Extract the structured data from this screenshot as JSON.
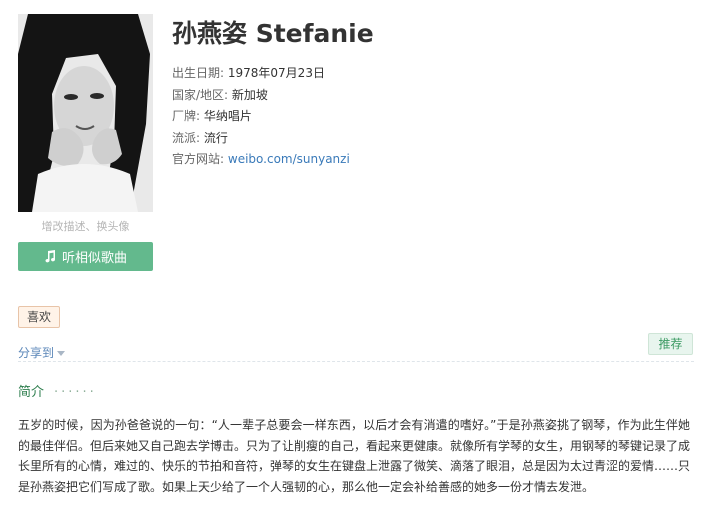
{
  "artist": {
    "name": "孙燕姿 Stefanie"
  },
  "photo": {
    "edit_label": "增改描述、换头像"
  },
  "actions": {
    "similar_songs_label": "听相似歌曲",
    "like_label": "喜欢",
    "share_label": "分享到",
    "recommend_label": "推荐"
  },
  "info": [
    {
      "label": "出生日期:",
      "value": "1978年07月23日"
    },
    {
      "label": "国家/地区:",
      "value": "新加坡"
    },
    {
      "label": "厂牌:",
      "value": "华纳唱片"
    },
    {
      "label": "流派:",
      "value": "流行"
    }
  ],
  "website": {
    "label": "官方网站:",
    "url": "weibo.com/sunyanzi"
  },
  "intro": {
    "heading": "简介",
    "dots": "······",
    "text": "五岁的时候，因为孙爸爸说的一句：“人一辈子总要会一样东西，以后才会有消遣的嗜好。”于是孙燕姿挑了钢琴，作为此生伴她的最佳伴侣。但后来她又自己跑去学博击。只为了让削瘦的自己，看起来更健康。就像所有学琴的女生，用钢琴的琴键记录了成长里所有的心情，难过的、快乐的节拍和音符，弹琴的女生在键盘上泄露了微笑、滴落了眼泪，总是因为太过青涩的爱情……只是孙燕姿把它们写成了歌。如果上天少给了一个人强韧的心，那么他一定会补给善感的她多一份才情去发泄。"
  },
  "icons": {
    "note": "music-note-icon",
    "caret": "caret-down-icon"
  },
  "colors": {
    "accent_green": "#63b98d",
    "link_blue": "#3a7ab9",
    "intro_green": "#2f7f4f"
  }
}
